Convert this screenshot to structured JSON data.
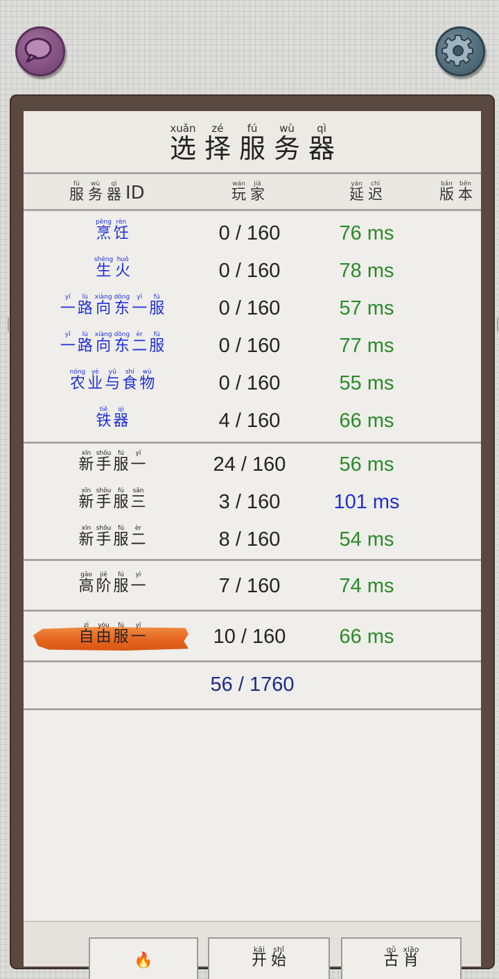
{
  "title": [
    {
      "py": "xuǎn",
      "hz": "选"
    },
    {
      "py": "zé",
      "hz": "择"
    },
    {
      "py": "fú",
      "hz": "服"
    },
    {
      "py": "wù",
      "hz": "务"
    },
    {
      "py": "qì",
      "hz": "器"
    }
  ],
  "headers": {
    "server_id": [
      {
        "py": "fú",
        "hz": "服"
      },
      {
        "py": "wù",
        "hz": "务"
      },
      {
        "py": "qì",
        "hz": "器"
      }
    ],
    "server_id_suffix": "ID",
    "players": [
      {
        "py": "wán",
        "hz": "玩"
      },
      {
        "py": "jiā",
        "hz": "家"
      }
    ],
    "ping": [
      {
        "py": "yán",
        "hz": "延"
      },
      {
        "py": "chí",
        "hz": "迟"
      }
    ],
    "version": [
      {
        "py": "bǎn",
        "hz": "版"
      },
      {
        "py": "běn",
        "hz": "本"
      }
    ]
  },
  "groups": [
    {
      "style": "blue",
      "rows": [
        {
          "name": [
            {
              "py": "pēng",
              "hz": "烹"
            },
            {
              "py": "rèn",
              "hz": "饪"
            }
          ],
          "players": "0 / 160",
          "ping": "76 ms",
          "ping_color": "green"
        },
        {
          "name": [
            {
              "py": "shēng",
              "hz": "生"
            },
            {
              "py": "huǒ",
              "hz": "火"
            }
          ],
          "players": "0 / 160",
          "ping": "78 ms",
          "ping_color": "green"
        },
        {
          "name": [
            {
              "py": "yī",
              "hz": "一"
            },
            {
              "py": "lù",
              "hz": "路"
            },
            {
              "py": "xiàng",
              "hz": "向"
            },
            {
              "py": "dōng",
              "hz": "东"
            },
            {
              "py": "yī",
              "hz": "一"
            },
            {
              "py": "fú",
              "hz": "服"
            }
          ],
          "players": "0 / 160",
          "ping": "57 ms",
          "ping_color": "green"
        },
        {
          "name": [
            {
              "py": "yī",
              "hz": "一"
            },
            {
              "py": "lù",
              "hz": "路"
            },
            {
              "py": "xiàng",
              "hz": "向"
            },
            {
              "py": "dōng",
              "hz": "东"
            },
            {
              "py": "èr",
              "hz": "二"
            },
            {
              "py": "fú",
              "hz": "服"
            }
          ],
          "players": "0 / 160",
          "ping": "77 ms",
          "ping_color": "green"
        },
        {
          "name": [
            {
              "py": "nóng",
              "hz": "农"
            },
            {
              "py": "yè",
              "hz": "业"
            },
            {
              "py": "yǔ",
              "hz": "与"
            },
            {
              "py": "shí",
              "hz": "食"
            },
            {
              "py": "wù",
              "hz": "物"
            }
          ],
          "players": "0 / 160",
          "ping": "55 ms",
          "ping_color": "green"
        },
        {
          "name": [
            {
              "py": "tiě",
              "hz": "铁"
            },
            {
              "py": "qì",
              "hz": "器"
            }
          ],
          "players": "4 / 160",
          "ping": "66 ms",
          "ping_color": "green"
        }
      ]
    },
    {
      "style": "black",
      "rows": [
        {
          "name": [
            {
              "py": "xīn",
              "hz": "新"
            },
            {
              "py": "shǒu",
              "hz": "手"
            },
            {
              "py": "fú",
              "hz": "服"
            },
            {
              "py": "yī",
              "hz": "一"
            }
          ],
          "players": "24 / 160",
          "ping": "56 ms",
          "ping_color": "green"
        },
        {
          "name": [
            {
              "py": "xīn",
              "hz": "新"
            },
            {
              "py": "shǒu",
              "hz": "手"
            },
            {
              "py": "fú",
              "hz": "服"
            },
            {
              "py": "sān",
              "hz": "三"
            }
          ],
          "players": "3 / 160",
          "ping": "101 ms",
          "ping_color": "blue"
        },
        {
          "name": [
            {
              "py": "xīn",
              "hz": "新"
            },
            {
              "py": "shǒu",
              "hz": "手"
            },
            {
              "py": "fú",
              "hz": "服"
            },
            {
              "py": "èr",
              "hz": "二"
            }
          ],
          "players": "8 / 160",
          "ping": "54 ms",
          "ping_color": "green"
        }
      ]
    },
    {
      "style": "black",
      "rows": [
        {
          "name": [
            {
              "py": "gāo",
              "hz": "高"
            },
            {
              "py": "jiē",
              "hz": "阶"
            },
            {
              "py": "fú",
              "hz": "服"
            },
            {
              "py": "yī",
              "hz": "一"
            }
          ],
          "players": "7 / 160",
          "ping": "74 ms",
          "ping_color": "green"
        }
      ]
    },
    {
      "style": "black",
      "selected": true,
      "rows": [
        {
          "name": [
            {
              "py": "zì",
              "hz": "自"
            },
            {
              "py": "yóu",
              "hz": "由"
            },
            {
              "py": "fú",
              "hz": "服"
            },
            {
              "py": "yī",
              "hz": "一"
            }
          ],
          "players": "10 / 160",
          "ping": "66 ms",
          "ping_color": "green"
        }
      ]
    }
  ],
  "total": "56 / 1760",
  "bottom_buttons": [
    {
      "label": [
        {
          "py": "",
          "hz": "🔥"
        }
      ]
    },
    {
      "label": [
        {
          "py": "kāi",
          "hz": "开"
        },
        {
          "py": "shǐ",
          "hz": "始"
        }
      ]
    },
    {
      "label": [
        {
          "py": "gǔ",
          "hz": "古"
        },
        {
          "py": "xiāo",
          "hz": "肖"
        }
      ]
    }
  ],
  "colors": {
    "ping_green": "#2a8a2a",
    "ping_blue": "#1f2fd6",
    "name_blue": "#1f2fe0",
    "total": "#1a2a8a",
    "selected_brush": "#e5651f"
  },
  "icons": {
    "chat": "chat-bubble-icon",
    "settings": "gear-icon"
  }
}
